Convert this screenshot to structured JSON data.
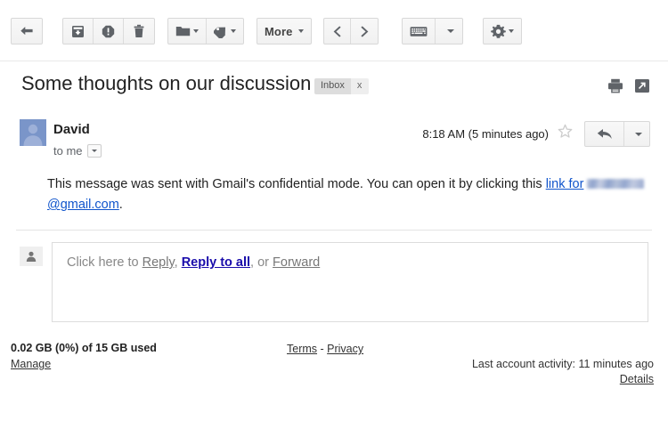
{
  "toolbar": {
    "back_icon": "back-arrow-icon",
    "archive_icon": "archive-icon",
    "spam_icon": "report-spam-icon",
    "delete_icon": "trash-icon",
    "move_icon": "folder-icon",
    "label_icon": "tag-icon",
    "more_label": "More",
    "prev_icon": "chevron-left-icon",
    "next_icon": "chevron-right-icon",
    "density_icon": "keyboard-icon",
    "settings_icon": "gear-icon"
  },
  "header": {
    "subject": "Some thoughts on our discussion",
    "label_chip": "Inbox",
    "label_chip_remove": "x",
    "print_icon": "printer-icon",
    "popout_icon": "open-in-new-window-icon"
  },
  "message": {
    "sender": "David",
    "recipient": "to me",
    "timestamp": "8:18 AM (5 minutes ago)",
    "star_icon": "star-outline-icon",
    "reply_icon": "reply-arrow-icon",
    "avatar_icon": "person-avatar-icon",
    "body": {
      "part1": "This message was sent with Gmail's confidential mode. You can open it by clicking this ",
      "link_text_1": "link for",
      "link_text_2": "@gmail.com",
      "redacted_note": "",
      "period": "."
    }
  },
  "reply": {
    "prefix": "Click here to ",
    "reply_label": "Reply",
    "comma": ", ",
    "reply_all_label": "Reply to all",
    "or_text": ", or ",
    "forward_label": "Forward",
    "avatar_icon": "person-small-icon"
  },
  "footer": {
    "storage": "0.02 GB (0%) of 15 GB used",
    "manage": "Manage",
    "terms": "Terms",
    "separator": " - ",
    "privacy": "Privacy",
    "activity": "Last account activity: 11 minutes ago",
    "details": "Details"
  },
  "colors": {
    "link_blue": "#1155cc",
    "reply_all_blue": "#1a0dab",
    "avatar_blue": "#7a95c9",
    "chip_gray": "#dddddd"
  }
}
